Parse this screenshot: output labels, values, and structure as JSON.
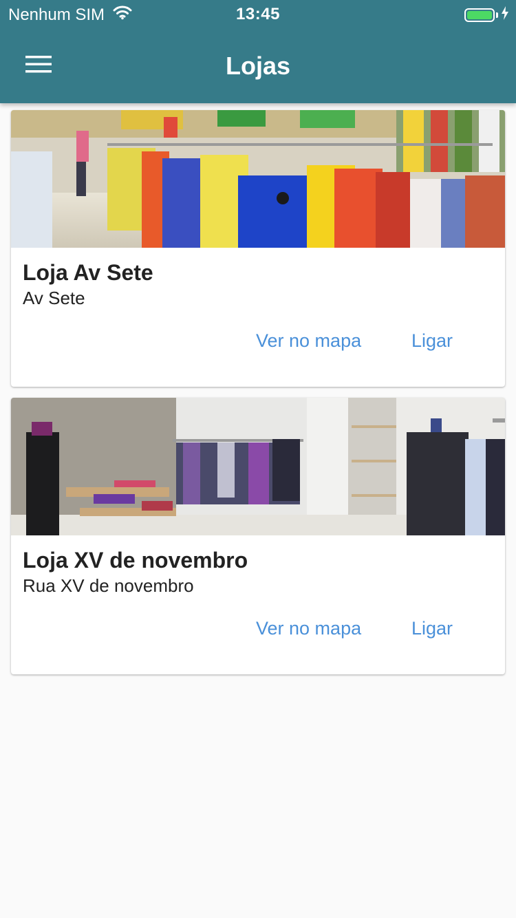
{
  "status_bar": {
    "carrier": "Nenhum SIM",
    "time": "13:45",
    "battery_color": "#4cd964"
  },
  "header": {
    "title": "Lojas",
    "background_color": "#367b89",
    "menu_icon": "hamburger-menu-icon"
  },
  "stores": [
    {
      "name": "Loja Av Sete",
      "address": "Av Sete",
      "image_description": "clothing store racks with colorful shirts",
      "map_label": "Ver no mapa",
      "call_label": "Ligar"
    },
    {
      "name": "Loja XV de novembro",
      "address": "Rua XV de novembro",
      "image_description": "clothing store interior with jackets and shelves",
      "map_label": "Ver no mapa",
      "call_label": "Ligar"
    }
  ],
  "accent_color": "#4a90d9"
}
